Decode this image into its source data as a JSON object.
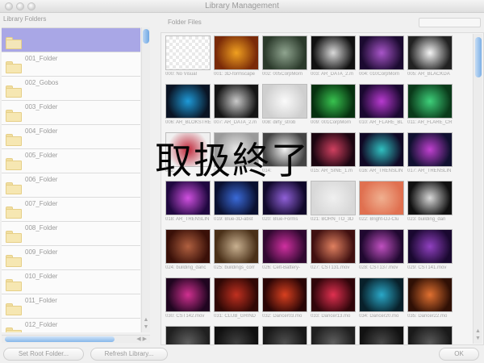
{
  "window": {
    "title": "Library Management"
  },
  "sidebar": {
    "header": "Library Folders",
    "folders": [
      {
        "label": "",
        "selected": true
      },
      {
        "label": "001_Folder"
      },
      {
        "label": "002_Gobos"
      },
      {
        "label": "003_Folder"
      },
      {
        "label": "004_Folder"
      },
      {
        "label": "005_Folder"
      },
      {
        "label": "006_Folder"
      },
      {
        "label": "007_Folder"
      },
      {
        "label": "008_Folder"
      },
      {
        "label": "009_Folder"
      },
      {
        "label": "010_Folder"
      },
      {
        "label": "011_Folder"
      },
      {
        "label": "012_Folder"
      }
    ]
  },
  "files": {
    "header": "Folder Files",
    "thumbnails": [
      {
        "label": "000: No Visual",
        "c1": "#e9e9e9",
        "c2": "#ffffff",
        "pattern": "checker"
      },
      {
        "label": "001: 3D-formscape",
        "c1": "#f0a020",
        "c2": "#7a2a08"
      },
      {
        "label": "002: 005CorpMorn",
        "c1": "#8fa48f",
        "c2": "#2b3a2b"
      },
      {
        "label": "003: AR_DATA_2.m",
        "c1": "#d9d9d9",
        "c2": "#111111"
      },
      {
        "label": "004: 010CorpMorn",
        "c1": "#a855c9",
        "c2": "#1b0a30"
      },
      {
        "label": "005: AR_BLACKDA",
        "c1": "#f4f4f4",
        "c2": "#222222"
      },
      {
        "label": "006: AR_BLOKSTRE",
        "c1": "#1e9ad8",
        "c2": "#0a1424"
      },
      {
        "label": "007: AR_DATA_2.m",
        "c1": "#c9c9c9",
        "c2": "#151515"
      },
      {
        "label": "008: dirty_strob",
        "c1": "#fafafa",
        "c2": "#cfcfcf"
      },
      {
        "label": "009: 001CorpMorn",
        "c1": "#38c24f",
        "c2": "#06300f"
      },
      {
        "label": "010: AR_FLARE_BL",
        "c1": "#b83ad0",
        "c2": "#1a0830"
      },
      {
        "label": "011: AR_FLARE_CR",
        "c1": "#3ed07a",
        "c2": "#0a3a1a"
      },
      {
        "label": "012: ",
        "c1": "#c0273a",
        "c2": "#f0f0f0"
      },
      {
        "label": "013: ",
        "c1": "#e8e8e8",
        "c2": "#9a9a9a"
      },
      {
        "label": "014: ",
        "c1": "#f0f0f0",
        "c2": "#444444"
      },
      {
        "label": "015: AR_SINE_1.m",
        "c1": "#d04060",
        "c2": "#1a0510"
      },
      {
        "label": "016: AR_TRENSLIN",
        "c1": "#30c0c0",
        "c2": "#100825"
      },
      {
        "label": "017: AR_TRENSLIN",
        "c1": "#c040d0",
        "c2": "#101030"
      },
      {
        "label": "018: AR_TRENSLIN",
        "c1": "#d050e0",
        "c2": "#200840"
      },
      {
        "label": "019: Blue-3D-abst",
        "c1": "#3a6ad8",
        "c2": "#0a1030"
      },
      {
        "label": "020: Blue-Forms",
        "c1": "#9060d8",
        "c2": "#10082a"
      },
      {
        "label": "021: BORN_TO_3D",
        "c1": "#f0f0f0",
        "c2": "#d8d8d8"
      },
      {
        "label": "022: Bright-DJ-Clu",
        "c1": "#f0b090",
        "c2": "#e07050"
      },
      {
        "label": "023: building_dan",
        "c1": "#d8d8d8",
        "c2": "#101010"
      },
      {
        "label": "024: building_danc",
        "c1": "#b06040",
        "c2": "#3a1008"
      },
      {
        "label": "025: buildings_corr",
        "c1": "#c8b090",
        "c2": "#4a3018"
      },
      {
        "label": "026: Celt-Battery-",
        "c1": "#d030a0",
        "c2": "#300830"
      },
      {
        "label": "027: CST131.mov",
        "c1": "#e08060",
        "c2": "#401010"
      },
      {
        "label": "028: CST137.mov",
        "c1": "#c050c0",
        "c2": "#200830"
      },
      {
        "label": "029: CST141.mov",
        "c1": "#9040c0",
        "c2": "#1a0830"
      },
      {
        "label": "030: CST142.mov",
        "c1": "#d03090",
        "c2": "#200520"
      },
      {
        "label": "031: CLUB_GRIND",
        "c1": "#c03020",
        "c2": "#300805"
      },
      {
        "label": "032: Dancer03.mo",
        "c1": "#d84020",
        "c2": "#2a0505"
      },
      {
        "label": "033: Dancer13.mo",
        "c1": "#e03050",
        "c2": "#30050a"
      },
      {
        "label": "034: Dancer20.mo",
        "c1": "#2aa8c8",
        "c2": "#08202a"
      },
      {
        "label": "035: Dancer22.mo",
        "c1": "#e07030",
        "c2": "#301005"
      },
      {
        "label": "",
        "c1": "#606060",
        "c2": "#202020"
      },
      {
        "label": "",
        "c1": "#404040",
        "c2": "#101010"
      },
      {
        "label": "",
        "c1": "#505050",
        "c2": "#181818"
      },
      {
        "label": "",
        "c1": "#606060",
        "c2": "#202020"
      },
      {
        "label": "",
        "c1": "#4a4a4a",
        "c2": "#121212"
      },
      {
        "label": "",
        "c1": "#5a5a5a",
        "c2": "#1a1a1a"
      }
    ]
  },
  "buttons": {
    "set_root": "Set Root Folder...",
    "refresh": "Refresh Library...",
    "ok": "OK"
  },
  "stamp_text": "取扱終了"
}
